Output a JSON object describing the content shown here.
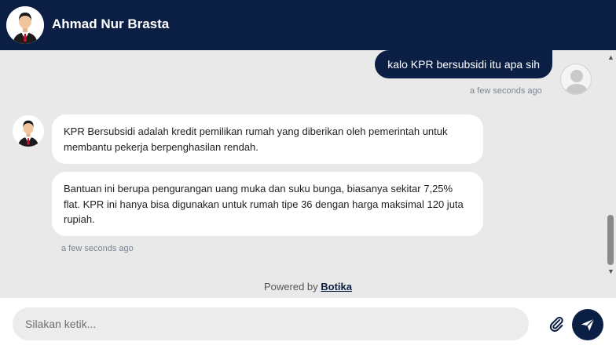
{
  "header": {
    "bot_name": "Ahmad Nur Brasta"
  },
  "messages": {
    "user_1": {
      "text": "kalo KPR bersubsidi itu apa sih",
      "time": "a few seconds ago"
    },
    "bot_1": {
      "text": "KPR Bersubsidi adalah kredit pemilikan rumah yang diberikan oleh pemerintah untuk membantu pekerja berpenghasilan rendah."
    },
    "bot_2": {
      "text": "Bantuan ini berupa pengurangan uang muka dan suku bunga, biasanya sekitar 7,25% flat. KPR ini hanya bisa digunakan untuk rumah tipe 36 dengan harga maksimal 120 juta rupiah."
    },
    "bot_time": "a few seconds ago"
  },
  "powered": {
    "prefix": "Powered by",
    "brand": "Botika"
  },
  "composer": {
    "placeholder": "Silakan ketik...",
    "attach_icon": "paperclip-icon",
    "send_icon": "send-icon"
  },
  "colors": {
    "primary": "#0b1f45",
    "background": "#e9e9e9",
    "bubble_bot": "#ffffff"
  }
}
